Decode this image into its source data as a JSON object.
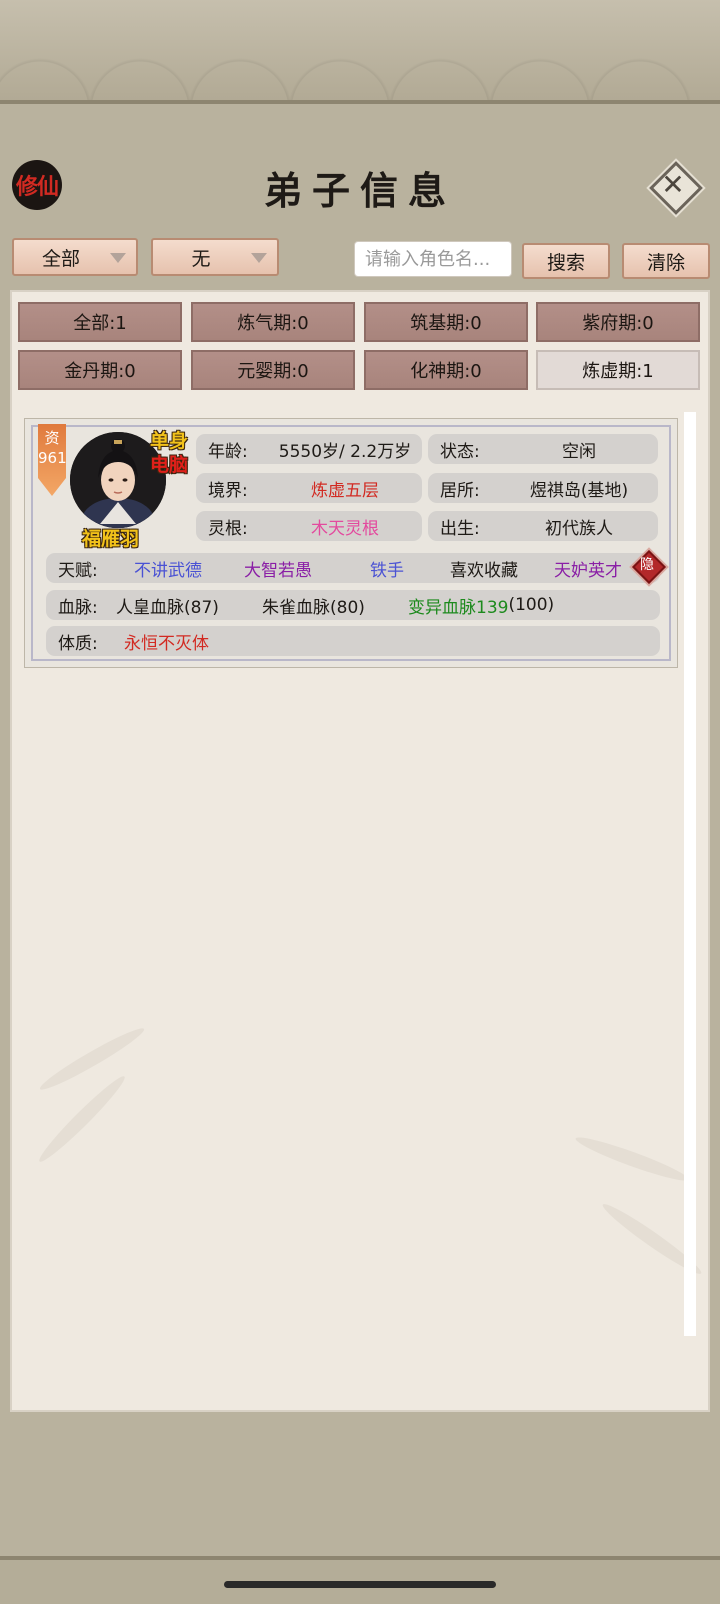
{
  "header": {
    "seal_text": "修仙",
    "title": "弟子信息",
    "close_icon": "close-x-icon"
  },
  "filters": {
    "dropdown_1": "全部",
    "dropdown_2": "无",
    "search_placeholder": "请输入角色名...",
    "search_button": "搜索",
    "clear_button": "清除"
  },
  "realm_tabs": [
    {
      "label": "全部:1"
    },
    {
      "label": "炼气期:0"
    },
    {
      "label": "筑基期:0"
    },
    {
      "label": "紫府期:0"
    },
    {
      "label": "金丹期:0"
    },
    {
      "label": "元婴期:0"
    },
    {
      "label": "化神期:0"
    },
    {
      "label": "炼虚期:1",
      "active": true
    }
  ],
  "disciple": {
    "zi_badge": "资\n961",
    "tag_single": "单身",
    "tag_computer": "电脑",
    "name": "福雁羽",
    "age_label": "年龄:",
    "age_value": "5550岁/ 2.2万岁",
    "status_label": "状态:",
    "status_value": "空闲",
    "realm_label": "境界:",
    "realm_value": "炼虚五层",
    "residence_label": "居所:",
    "residence_value": "煜祺岛(基地)",
    "root_label": "灵根:",
    "root_value": "木天灵根",
    "birth_label": "出生:",
    "birth_value": "初代族人",
    "talent_label": "天赋:",
    "talents": [
      "不讲武德",
      "大智若愚",
      "铁手",
      "喜欢收藏",
      "天妒英才"
    ],
    "hide_badge": "隐",
    "bloodline_label": "血脉:",
    "bloodline_1": "人皇血脉(87)",
    "bloodline_2": "朱雀血脉(80)",
    "bloodline_3_name": "变异血脉139",
    "bloodline_3_value": "(100)",
    "physique_label": "体质:",
    "physique_value": "永恒不灭体"
  },
  "colors": {
    "red_text": "#d22a22",
    "pink_text": "#e34a9e",
    "blue_text": "#4a52d4",
    "purple_text": "#8a1fa6",
    "green_text": "#1d8a1d"
  }
}
